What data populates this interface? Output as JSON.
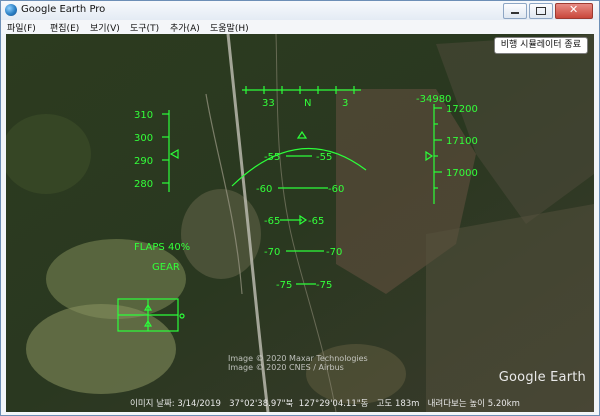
{
  "window": {
    "title": "Google Earth Pro"
  },
  "menu": [
    "파일(F)",
    "편집(E)",
    "보기(V)",
    "도구(T)",
    "추가(A)",
    "도움말(H)"
  ],
  "exit_button": "비행 시뮬레이터 종료",
  "hud": {
    "heading": [
      "33",
      "N",
      "3"
    ],
    "speed_ticks": [
      "310",
      "300",
      "290",
      "280"
    ],
    "altitude_top": "-34980",
    "altitude_ticks": [
      "17200",
      "17100",
      "17000"
    ],
    "pitch": [
      "-55",
      "-55",
      "-60",
      "-60",
      "-65",
      "-65",
      "-70",
      "-70",
      "-75",
      "-75"
    ],
    "flaps": "FLAPS 40%",
    "gear": "GEAR"
  },
  "credits": [
    "Image © 2020 Maxar Technologies",
    "Image © 2020 CNES / Airbus"
  ],
  "logo": "Google Earth",
  "status": {
    "image_date_label": "이미지 날짜:",
    "image_date": "3/14/2019",
    "lat": "37°02'38.97\"북",
    "lon": "127°29'04.11\"동",
    "elev_label": "고도",
    "elev": "183m",
    "eye_label": "내려다보는 높이",
    "eye": "5.20km"
  }
}
